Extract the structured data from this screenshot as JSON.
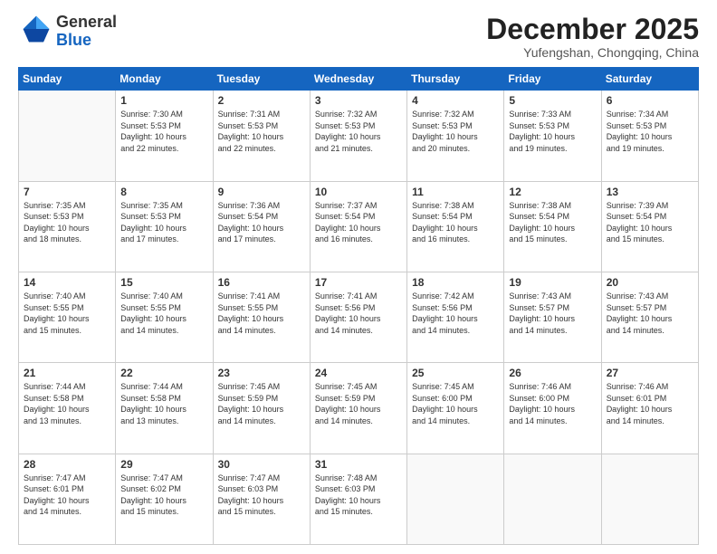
{
  "logo": {
    "general": "General",
    "blue": "Blue"
  },
  "header": {
    "month": "December 2025",
    "location": "Yufengshan, Chongqing, China"
  },
  "days_of_week": [
    "Sunday",
    "Monday",
    "Tuesday",
    "Wednesday",
    "Thursday",
    "Friday",
    "Saturday"
  ],
  "weeks": [
    [
      {
        "day": "",
        "info": ""
      },
      {
        "day": "1",
        "info": "Sunrise: 7:30 AM\nSunset: 5:53 PM\nDaylight: 10 hours\nand 22 minutes."
      },
      {
        "day": "2",
        "info": "Sunrise: 7:31 AM\nSunset: 5:53 PM\nDaylight: 10 hours\nand 22 minutes."
      },
      {
        "day": "3",
        "info": "Sunrise: 7:32 AM\nSunset: 5:53 PM\nDaylight: 10 hours\nand 21 minutes."
      },
      {
        "day": "4",
        "info": "Sunrise: 7:32 AM\nSunset: 5:53 PM\nDaylight: 10 hours\nand 20 minutes."
      },
      {
        "day": "5",
        "info": "Sunrise: 7:33 AM\nSunset: 5:53 PM\nDaylight: 10 hours\nand 19 minutes."
      },
      {
        "day": "6",
        "info": "Sunrise: 7:34 AM\nSunset: 5:53 PM\nDaylight: 10 hours\nand 19 minutes."
      }
    ],
    [
      {
        "day": "7",
        "info": "Sunrise: 7:35 AM\nSunset: 5:53 PM\nDaylight: 10 hours\nand 18 minutes."
      },
      {
        "day": "8",
        "info": "Sunrise: 7:35 AM\nSunset: 5:53 PM\nDaylight: 10 hours\nand 17 minutes."
      },
      {
        "day": "9",
        "info": "Sunrise: 7:36 AM\nSunset: 5:54 PM\nDaylight: 10 hours\nand 17 minutes."
      },
      {
        "day": "10",
        "info": "Sunrise: 7:37 AM\nSunset: 5:54 PM\nDaylight: 10 hours\nand 16 minutes."
      },
      {
        "day": "11",
        "info": "Sunrise: 7:38 AM\nSunset: 5:54 PM\nDaylight: 10 hours\nand 16 minutes."
      },
      {
        "day": "12",
        "info": "Sunrise: 7:38 AM\nSunset: 5:54 PM\nDaylight: 10 hours\nand 15 minutes."
      },
      {
        "day": "13",
        "info": "Sunrise: 7:39 AM\nSunset: 5:54 PM\nDaylight: 10 hours\nand 15 minutes."
      }
    ],
    [
      {
        "day": "14",
        "info": "Sunrise: 7:40 AM\nSunset: 5:55 PM\nDaylight: 10 hours\nand 15 minutes."
      },
      {
        "day": "15",
        "info": "Sunrise: 7:40 AM\nSunset: 5:55 PM\nDaylight: 10 hours\nand 14 minutes."
      },
      {
        "day": "16",
        "info": "Sunrise: 7:41 AM\nSunset: 5:55 PM\nDaylight: 10 hours\nand 14 minutes."
      },
      {
        "day": "17",
        "info": "Sunrise: 7:41 AM\nSunset: 5:56 PM\nDaylight: 10 hours\nand 14 minutes."
      },
      {
        "day": "18",
        "info": "Sunrise: 7:42 AM\nSunset: 5:56 PM\nDaylight: 10 hours\nand 14 minutes."
      },
      {
        "day": "19",
        "info": "Sunrise: 7:43 AM\nSunset: 5:57 PM\nDaylight: 10 hours\nand 14 minutes."
      },
      {
        "day": "20",
        "info": "Sunrise: 7:43 AM\nSunset: 5:57 PM\nDaylight: 10 hours\nand 14 minutes."
      }
    ],
    [
      {
        "day": "21",
        "info": "Sunrise: 7:44 AM\nSunset: 5:58 PM\nDaylight: 10 hours\nand 13 minutes."
      },
      {
        "day": "22",
        "info": "Sunrise: 7:44 AM\nSunset: 5:58 PM\nDaylight: 10 hours\nand 13 minutes."
      },
      {
        "day": "23",
        "info": "Sunrise: 7:45 AM\nSunset: 5:59 PM\nDaylight: 10 hours\nand 14 minutes."
      },
      {
        "day": "24",
        "info": "Sunrise: 7:45 AM\nSunset: 5:59 PM\nDaylight: 10 hours\nand 14 minutes."
      },
      {
        "day": "25",
        "info": "Sunrise: 7:45 AM\nSunset: 6:00 PM\nDaylight: 10 hours\nand 14 minutes."
      },
      {
        "day": "26",
        "info": "Sunrise: 7:46 AM\nSunset: 6:00 PM\nDaylight: 10 hours\nand 14 minutes."
      },
      {
        "day": "27",
        "info": "Sunrise: 7:46 AM\nSunset: 6:01 PM\nDaylight: 10 hours\nand 14 minutes."
      }
    ],
    [
      {
        "day": "28",
        "info": "Sunrise: 7:47 AM\nSunset: 6:01 PM\nDaylight: 10 hours\nand 14 minutes."
      },
      {
        "day": "29",
        "info": "Sunrise: 7:47 AM\nSunset: 6:02 PM\nDaylight: 10 hours\nand 15 minutes."
      },
      {
        "day": "30",
        "info": "Sunrise: 7:47 AM\nSunset: 6:03 PM\nDaylight: 10 hours\nand 15 minutes."
      },
      {
        "day": "31",
        "info": "Sunrise: 7:48 AM\nSunset: 6:03 PM\nDaylight: 10 hours\nand 15 minutes."
      },
      {
        "day": "",
        "info": ""
      },
      {
        "day": "",
        "info": ""
      },
      {
        "day": "",
        "info": ""
      }
    ]
  ]
}
